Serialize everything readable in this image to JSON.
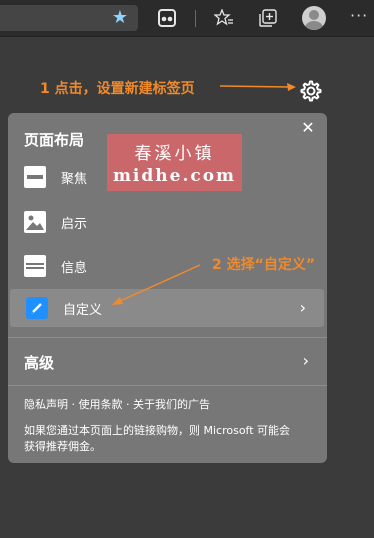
{
  "toolbar": {
    "icons": [
      "star-icon",
      "collections-icon",
      "favorites-icon",
      "tabs-icon",
      "profile-icon",
      "more-icon"
    ],
    "more_label": "···"
  },
  "annotations": {
    "step1": "1 点击，设置新建标签页",
    "step2": "2 选择“自定义”",
    "color": "#f08a2a"
  },
  "watermark": {
    "line1": "春溪小镇",
    "line2": "midhe.com"
  },
  "panel": {
    "title": "页面布局",
    "close_label": "✕",
    "layouts": [
      {
        "label": "聚焦"
      },
      {
        "label": "启示"
      },
      {
        "label": "信息"
      },
      {
        "label": "自定义"
      }
    ],
    "chevron": "›",
    "language_section": "高级",
    "footer_links": "隐私声明 · 使用条款 · 关于我们的广告",
    "footer_note_1": "如果您通过本页面上的链接购物，则 Microsoft 可能会",
    "footer_note_2": "获得推荐佣金。"
  }
}
